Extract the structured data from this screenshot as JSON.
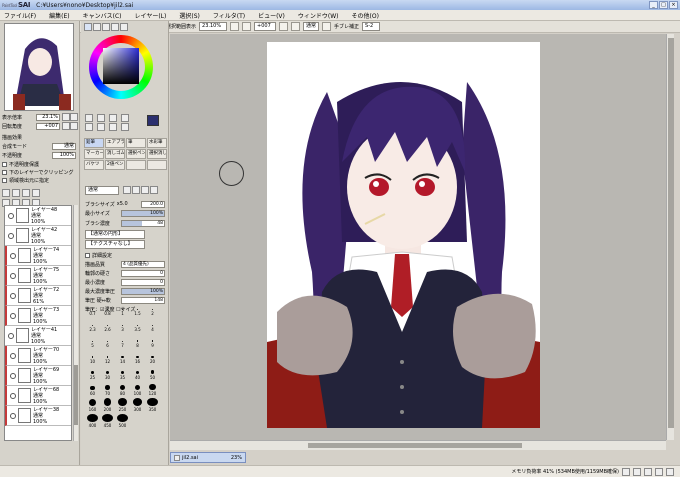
{
  "window": {
    "app_name": "SAI",
    "app_sub": "PaintTool",
    "title": "C:¥Users¥nono¥Desktop¥jil2.sai",
    "buttons": [
      "_",
      "□",
      "×"
    ]
  },
  "menu": [
    "ファイル(F)",
    "編集(E)",
    "キャンバス(C)",
    "レイヤー(L)",
    "選択(S)",
    "フィルタ(T)",
    "ビュー(V)",
    "ウィンドウ(W)",
    "その他(O)"
  ],
  "toolbar": {
    "show_selection": "選択範囲表示",
    "zoom": "23.10%",
    "angle": "+007",
    "mode": "通常",
    "stab_label": "手ブレ補正",
    "stab_value": "S-2"
  },
  "nav": {
    "zoom_label": "表示倍率",
    "zoom_value": "23.1%",
    "angle_label": "回転角度",
    "angle_value": "+007"
  },
  "layer_props": {
    "effects": "描画効果",
    "blend_label": "合成モード",
    "blend_value": "通常",
    "opacity_label": "不透明度",
    "opacity_value": "100%",
    "protect": "不透明度保護",
    "clip": "下のレイヤーでクリッピング",
    "ref": "領域検出元に指定"
  },
  "color": {
    "primary": "#2b2f6e",
    "secondary": "#ffffff",
    "wheel_value": "hsv"
  },
  "tools": [
    "鉛筆",
    "エアブラシ",
    "筆",
    "水彩筆",
    "マーカー",
    "消しゴム",
    "選択ペン",
    "選択消し",
    "バケツ",
    "2値ペン",
    "",
    ""
  ],
  "tool_mode": "通常",
  "brush": {
    "size_label": "ブラシサイズ",
    "size_mult": "x5.0",
    "size_value": "200.0",
    "min_label": "最小サイズ",
    "min_value": "100%",
    "density_label": "ブラシ濃度",
    "density_value": "48",
    "shape": "【通常の円形】",
    "texture": "【テクスチャなし】",
    "detail": "詳細設定",
    "quality_label": "描画品質",
    "quality_value": "4 (品質優先)",
    "hard_label": "輪郭の硬さ",
    "hard_value": "0",
    "min_density_label": "最小濃度",
    "min_density_value": "0",
    "max_pressure_label": "最大濃度筆圧",
    "max_pressure_value": "100%",
    "pressure_label": "筆圧 硬⇔軟",
    "pressure_value": "148",
    "pressure_opts": "筆圧：☑濃度 ☐サイズ"
  },
  "brush_sizes": [
    "0.7",
    "0.8",
    "1",
    "1.5",
    "2",
    "2.3",
    "2.6",
    "3",
    "3.5",
    "4",
    "5",
    "6",
    "7",
    "8",
    "9",
    "10",
    "12",
    "14",
    "16",
    "20",
    "25",
    "30",
    "35",
    "40",
    "50",
    "60",
    "70",
    "80",
    "100",
    "120",
    "160",
    "200",
    "250",
    "300",
    "350",
    "400",
    "450",
    "500"
  ],
  "layers": [
    {
      "name": "レイヤー48",
      "mode": "通常",
      "opacity": "100%",
      "red": false
    },
    {
      "name": "レイヤー42",
      "mode": "通常",
      "opacity": "100%",
      "red": false
    },
    {
      "name": "レイヤー74",
      "mode": "通常",
      "opacity": "100%",
      "red": true
    },
    {
      "name": "レイヤー75",
      "mode": "通常",
      "opacity": "100%",
      "red": true
    },
    {
      "name": "レイヤー72",
      "mode": "通常",
      "opacity": "61%",
      "red": true
    },
    {
      "name": "レイヤー73",
      "mode": "通常",
      "opacity": "100%",
      "red": true
    },
    {
      "name": "レイヤー41",
      "mode": "通常",
      "opacity": "100%",
      "red": false
    },
    {
      "name": "レイヤー70",
      "mode": "通常",
      "opacity": "100%",
      "red": true
    },
    {
      "name": "レイヤー69",
      "mode": "通常",
      "opacity": "100%",
      "red": true
    },
    {
      "name": "レイヤー68",
      "mode": "通常",
      "opacity": "100%",
      "red": true
    },
    {
      "name": "レイヤー38",
      "mode": "通常",
      "opacity": "100%",
      "red": true
    }
  ],
  "file_tab": {
    "name": "jil2.sai",
    "zoom": "23%"
  },
  "status": {
    "memory": "メモリ負荷率 41% (534MB使用/1159MB確保)"
  }
}
